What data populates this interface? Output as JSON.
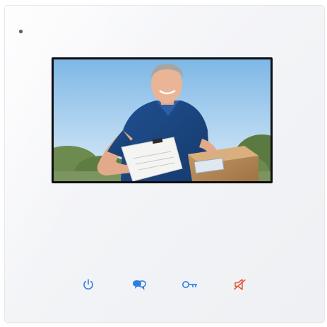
{
  "device": {
    "buttons": [
      {
        "id": "power",
        "icon": "power-icon",
        "color": "#2f7de0"
      },
      {
        "id": "talk",
        "icon": "chat-bubbles-icon",
        "color": "#2f7de0"
      },
      {
        "id": "unlock",
        "icon": "key-icon",
        "color": "#2f7de0"
      },
      {
        "id": "mute",
        "icon": "speaker-mute-icon",
        "color": "#e2553a"
      }
    ],
    "screen": {
      "content": "video-feed-icon"
    }
  }
}
